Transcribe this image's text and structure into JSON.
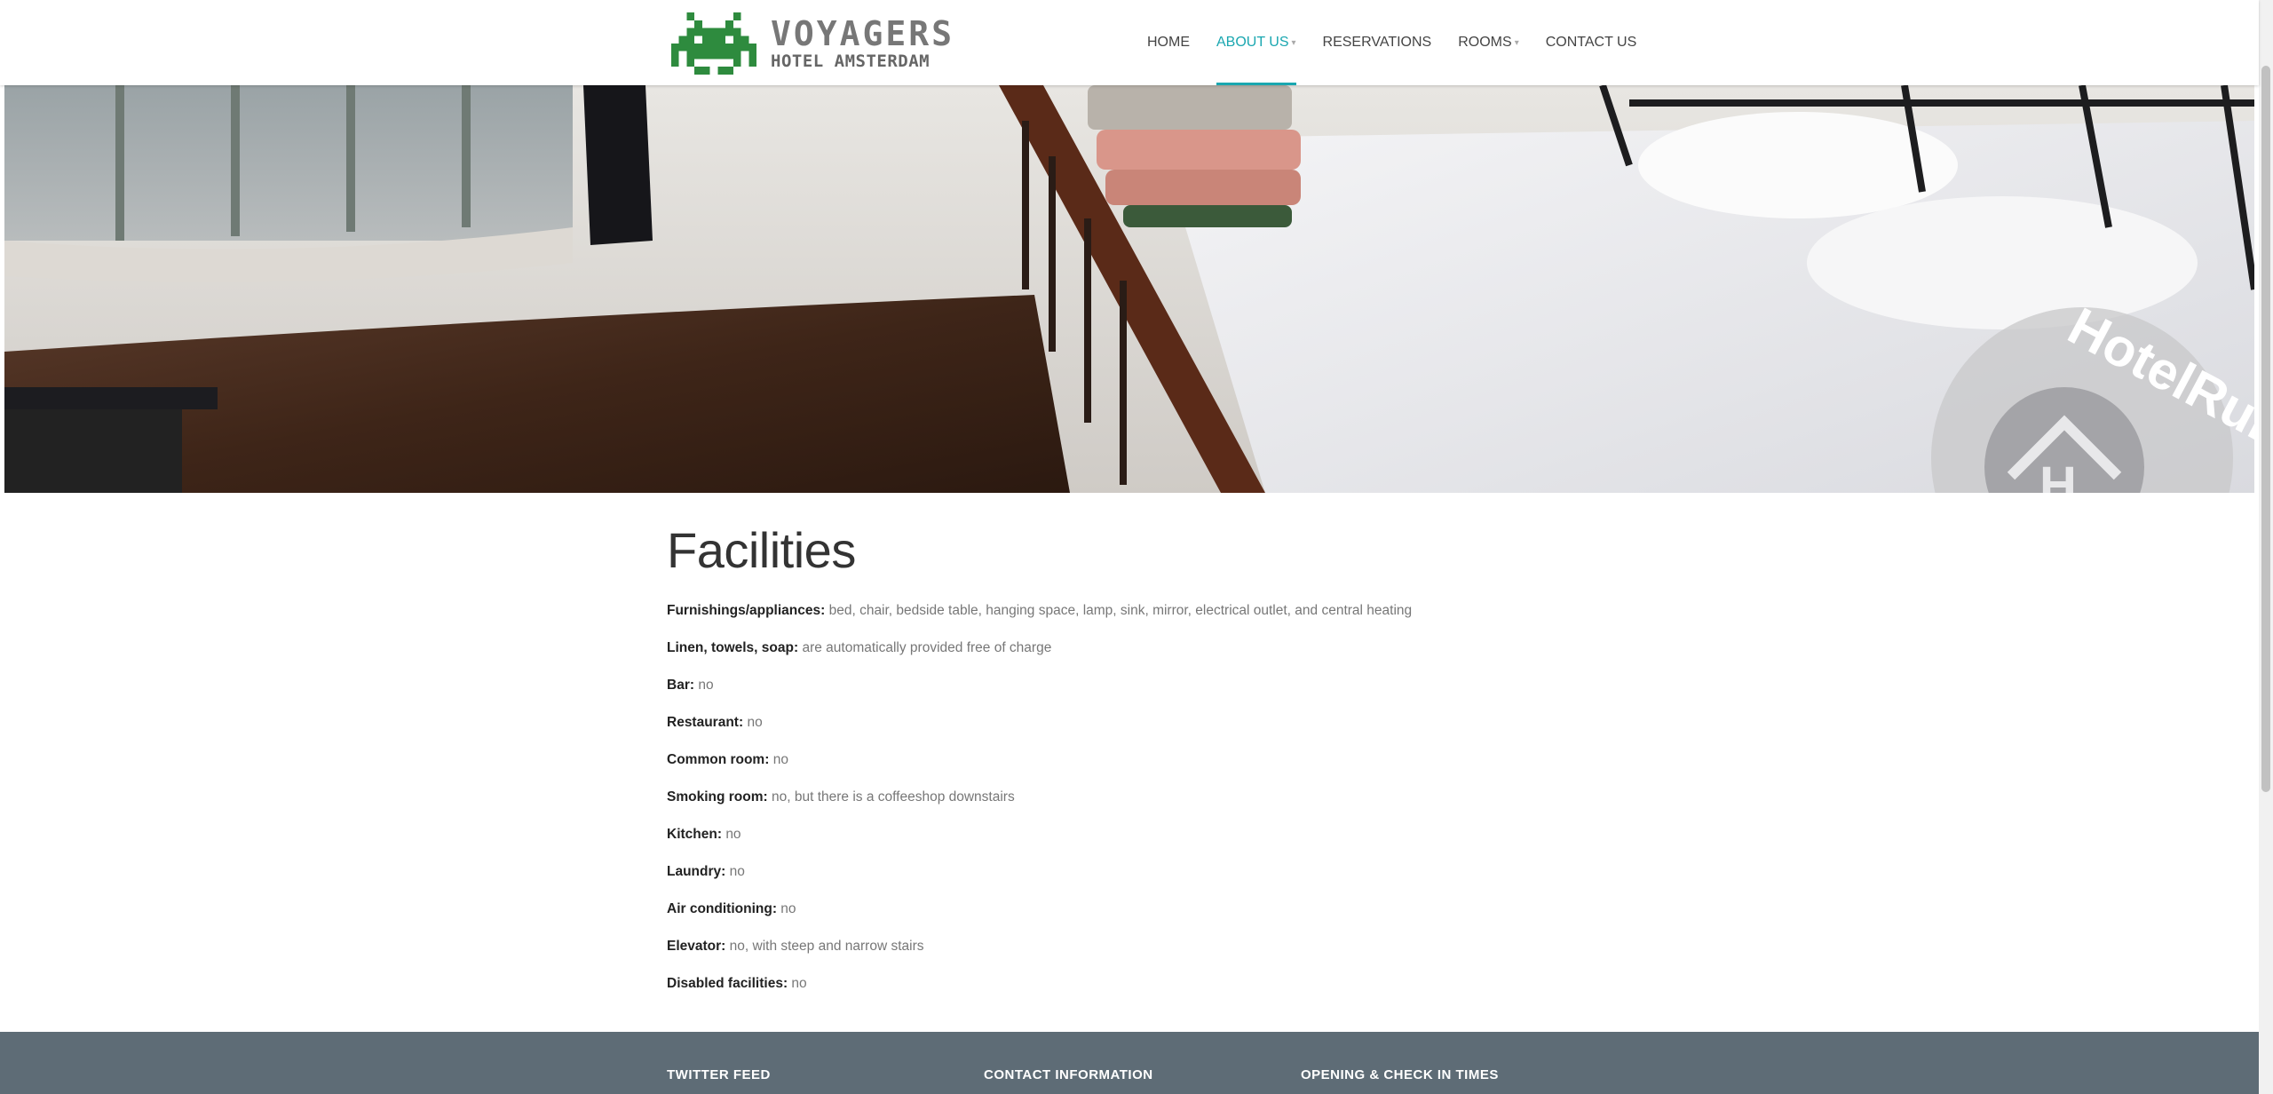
{
  "header": {
    "logo": {
      "title": "VOYAGERS",
      "subtitle": "HOTEL AMSTERDAM",
      "icon": "space-invader-icon",
      "color": "#2e8b3e"
    },
    "nav": [
      {
        "label": "HOME",
        "active": false,
        "dropdown": false
      },
      {
        "label": "ABOUT US",
        "active": true,
        "dropdown": true
      },
      {
        "label": "RESERVATIONS",
        "active": false,
        "dropdown": false
      },
      {
        "label": "ROOMS",
        "active": false,
        "dropdown": true
      },
      {
        "label": "CONTACT US",
        "active": false,
        "dropdown": false
      }
    ],
    "accent_color": "#1aa7b0"
  },
  "hero": {
    "watermark": "HotelRun",
    "watermark_icon": "house-h-icon"
  },
  "main": {
    "title": "Facilities",
    "facilities": [
      {
        "label": "Furnishings/appliances:",
        "value": "bed, chair, bedside table, hanging space, lamp, sink, mirror, electrical outlet, and central heating"
      },
      {
        "label": "Linen, towels, soap:",
        "value": "are automatically provided free of charge"
      },
      {
        "label": "Bar:",
        "value": "no"
      },
      {
        "label": "Restaurant:",
        "value": "no"
      },
      {
        "label": "Common room:",
        "value": "no"
      },
      {
        "label": "Smoking room:",
        "value": "no, but there is a coffeeshop downstairs"
      },
      {
        "label": "Kitchen:",
        "value": "no"
      },
      {
        "label": "Laundry:",
        "value": "no"
      },
      {
        "label": "Air conditioning:",
        "value": "no"
      },
      {
        "label": "Elevator:",
        "value": "no, with steep and narrow stairs"
      },
      {
        "label": "Disabled facilities:",
        "value": "no"
      }
    ]
  },
  "footer": {
    "columns": [
      "TWITTER FEED",
      "CONTACT INFORMATION",
      "OPENING & CHECK IN TIMES"
    ],
    "background": "#5e6c76"
  }
}
